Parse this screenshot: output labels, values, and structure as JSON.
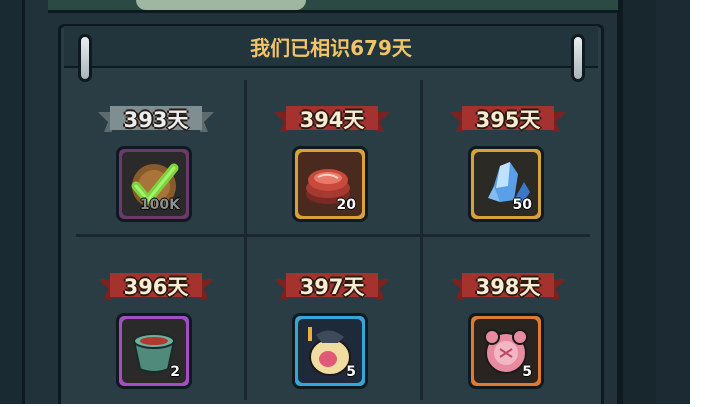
{
  "header": {
    "title": "我们已相识679天"
  },
  "rewards": [
    {
      "day_label": "393天",
      "qty": "100K",
      "icon": "gold-coin-claimed-icon",
      "claimed": true,
      "frame_color": "#6a3b6a"
    },
    {
      "day_label": "394天",
      "qty": "20",
      "icon": "raw-meat-icon",
      "claimed": false,
      "frame_color": "#d7a23a"
    },
    {
      "day_label": "395天",
      "qty": "50",
      "icon": "blue-crystal-icon",
      "claimed": false,
      "frame_color": "#d7a23a"
    },
    {
      "day_label": "396天",
      "qty": "2",
      "icon": "meat-pot-icon",
      "claimed": false,
      "frame_color": "#a24fc4"
    },
    {
      "day_label": "397天",
      "qty": "5",
      "icon": "pet-egg-icon",
      "claimed": false,
      "frame_color": "#35a6d6"
    },
    {
      "day_label": "398天",
      "qty": "5",
      "icon": "pink-cookie-icon",
      "claimed": false,
      "frame_color": "#e07a2e"
    }
  ],
  "colors": {
    "title": "#f2c46a",
    "ribbon_red": "#a6322f",
    "ribbon_gray": "#7f8e90",
    "panel": "#2a3c44"
  }
}
